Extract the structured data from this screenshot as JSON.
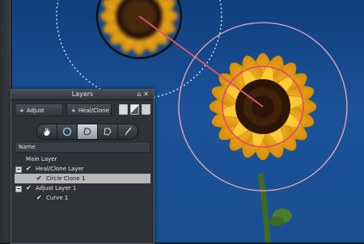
{
  "panel": {
    "title": "Layers",
    "title_icons": [
      "home-icon",
      "close-icon"
    ],
    "add_adjust_label": "Adjust",
    "add_heal_label": "Heal/Clone",
    "column_header": "Name"
  },
  "layers": [
    {
      "label": "Main Layer"
    },
    {
      "label": "Heal/Clone Layer"
    },
    {
      "label": "Circle Clone 1",
      "selected": true
    },
    {
      "label": "Adjust Layer 1"
    },
    {
      "label": "Curve 1"
    }
  ],
  "tools": [
    "hand-tool",
    "circle-clone-tool",
    "freeform-clone-tool",
    "polygon-clone-tool",
    "brush-tool"
  ],
  "colors": {
    "sky": "#1b5299",
    "petal": "#f2b91c",
    "clone_circle": "#e84a6a",
    "panel": "#2f3237"
  }
}
